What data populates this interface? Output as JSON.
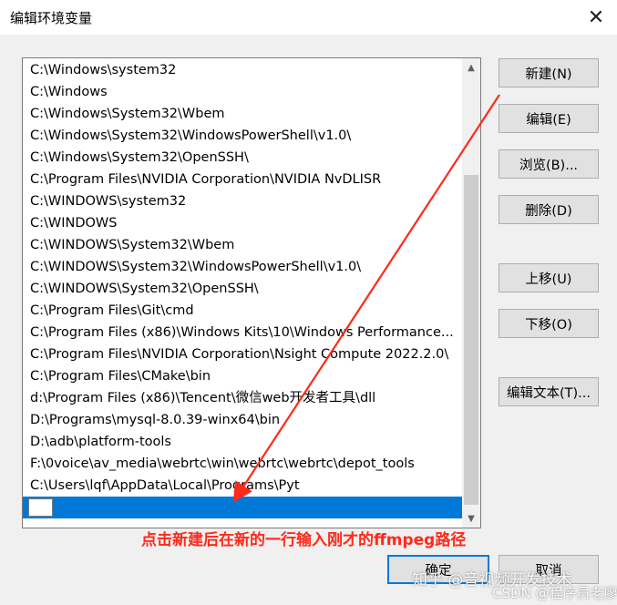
{
  "window": {
    "title": "编辑环境变量",
    "close_icon": "close-icon"
  },
  "path_list": {
    "items": [
      "C:\\Windows\\system32",
      "C:\\Windows",
      "C:\\Windows\\System32\\Wbem",
      "C:\\Windows\\System32\\WindowsPowerShell\\v1.0\\",
      "C:\\Windows\\System32\\OpenSSH\\",
      "C:\\Program Files\\NVIDIA Corporation\\NVIDIA NvDLISR",
      "C:\\WINDOWS\\system32",
      "C:\\WINDOWS",
      "C:\\WINDOWS\\System32\\Wbem",
      "C:\\WINDOWS\\System32\\WindowsPowerShell\\v1.0\\",
      "C:\\WINDOWS\\System32\\OpenSSH\\",
      "C:\\Program Files\\Git\\cmd",
      "C:\\Program Files (x86)\\Windows Kits\\10\\Windows Performance...",
      "C:\\Program Files\\NVIDIA Corporation\\Nsight Compute 2022.2.0\\",
      "C:\\Program Files\\CMake\\bin",
      "d:\\Program Files (x86)\\Tencent\\微信web开发者工具\\dll",
      "D:\\Programs\\mysql-8.0.39-winx64\\bin",
      "D:\\adb\\platform-tools",
      "F:\\0voice\\av_media\\webrtc\\win\\webrtc\\webrtc\\depot_tools",
      "C:\\Users\\lqf\\AppData\\Local\\Programs\\Pyt"
    ],
    "new_entry_value": ""
  },
  "buttons": {
    "new": "新建(N)",
    "edit": "编辑(E)",
    "browse": "浏览(B)...",
    "delete": "删除(D)",
    "move_up": "上移(U)",
    "move_down": "下移(O)",
    "edit_text": "编辑文本(T)...",
    "ok": "确定",
    "cancel": "取消"
  },
  "annotation": {
    "text": "点击新建后在新的一行输入刚才的ffmpeg路径",
    "color": "#ff2a1a"
  },
  "watermarks": {
    "line1": "知乎 @音视频开发技术",
    "line2": "CSDN @程序员老廖"
  },
  "colors": {
    "selection": "#0078d7",
    "default_button_border": "#0078d7",
    "annotation_arrow": "#ff2a1a"
  }
}
